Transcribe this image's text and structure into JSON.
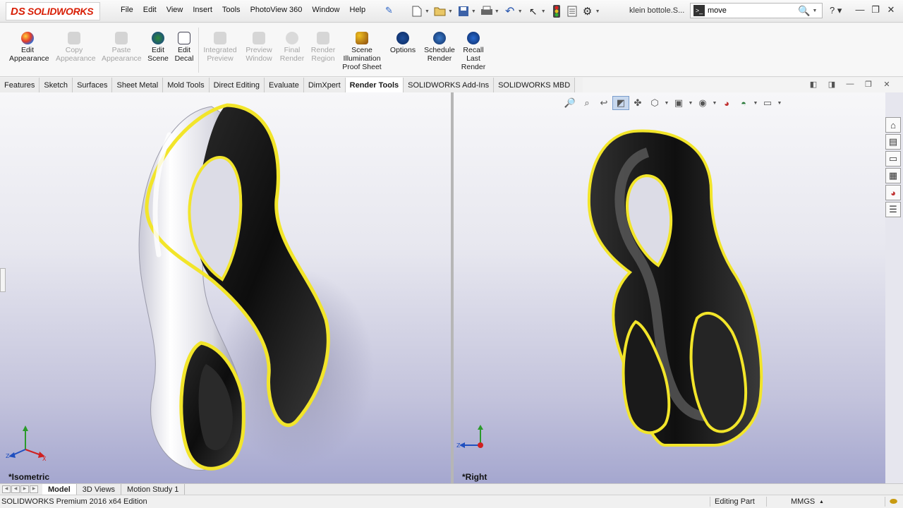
{
  "app": {
    "logo_prefix": "DS",
    "logo_text": "SOLIDWORKS",
    "document_title": "klein bottole.S...",
    "search_value": "move"
  },
  "menu": [
    "File",
    "Edit",
    "View",
    "Insert",
    "Tools",
    "PhotoView 360",
    "Window",
    "Help"
  ],
  "toolbar": {
    "edit_appearance": "Edit Appearance",
    "copy_appearance": "Copy Appearance",
    "paste_appearance": "Paste Appearance",
    "edit_scene": "Edit Scene",
    "edit_decal": "Edit Decal",
    "integrated_preview": "Integrated Preview",
    "preview_window": "Preview Window",
    "final_render": "Final Render",
    "render_region": "Render Region",
    "scene_illumination": "Scene Illumination Proof Sheet",
    "options": "Options",
    "schedule_render": "Schedule Render",
    "recall_last_render": "Recall Last Render"
  },
  "tabs": [
    "Features",
    "Sketch",
    "Surfaces",
    "Sheet Metal",
    "Mold Tools",
    "Direct Editing",
    "Evaluate",
    "DimXpert",
    "Render Tools",
    "SOLIDWORKS Add-Ins",
    "SOLIDWORKS MBD"
  ],
  "active_tab": "Render Tools",
  "viewports": {
    "left_label": "*Isometric",
    "right_label": "*Right"
  },
  "bottom_tabs": [
    "Model",
    "3D Views",
    "Motion Study 1"
  ],
  "status": {
    "edition": "SOLIDWORKS Premium 2016 x64 Edition",
    "mode": "Editing Part",
    "units": "MMGS"
  },
  "colors": {
    "brand_red": "#d81e05",
    "edge_highlight": "#f2e52a",
    "model_dark": "#151515"
  }
}
